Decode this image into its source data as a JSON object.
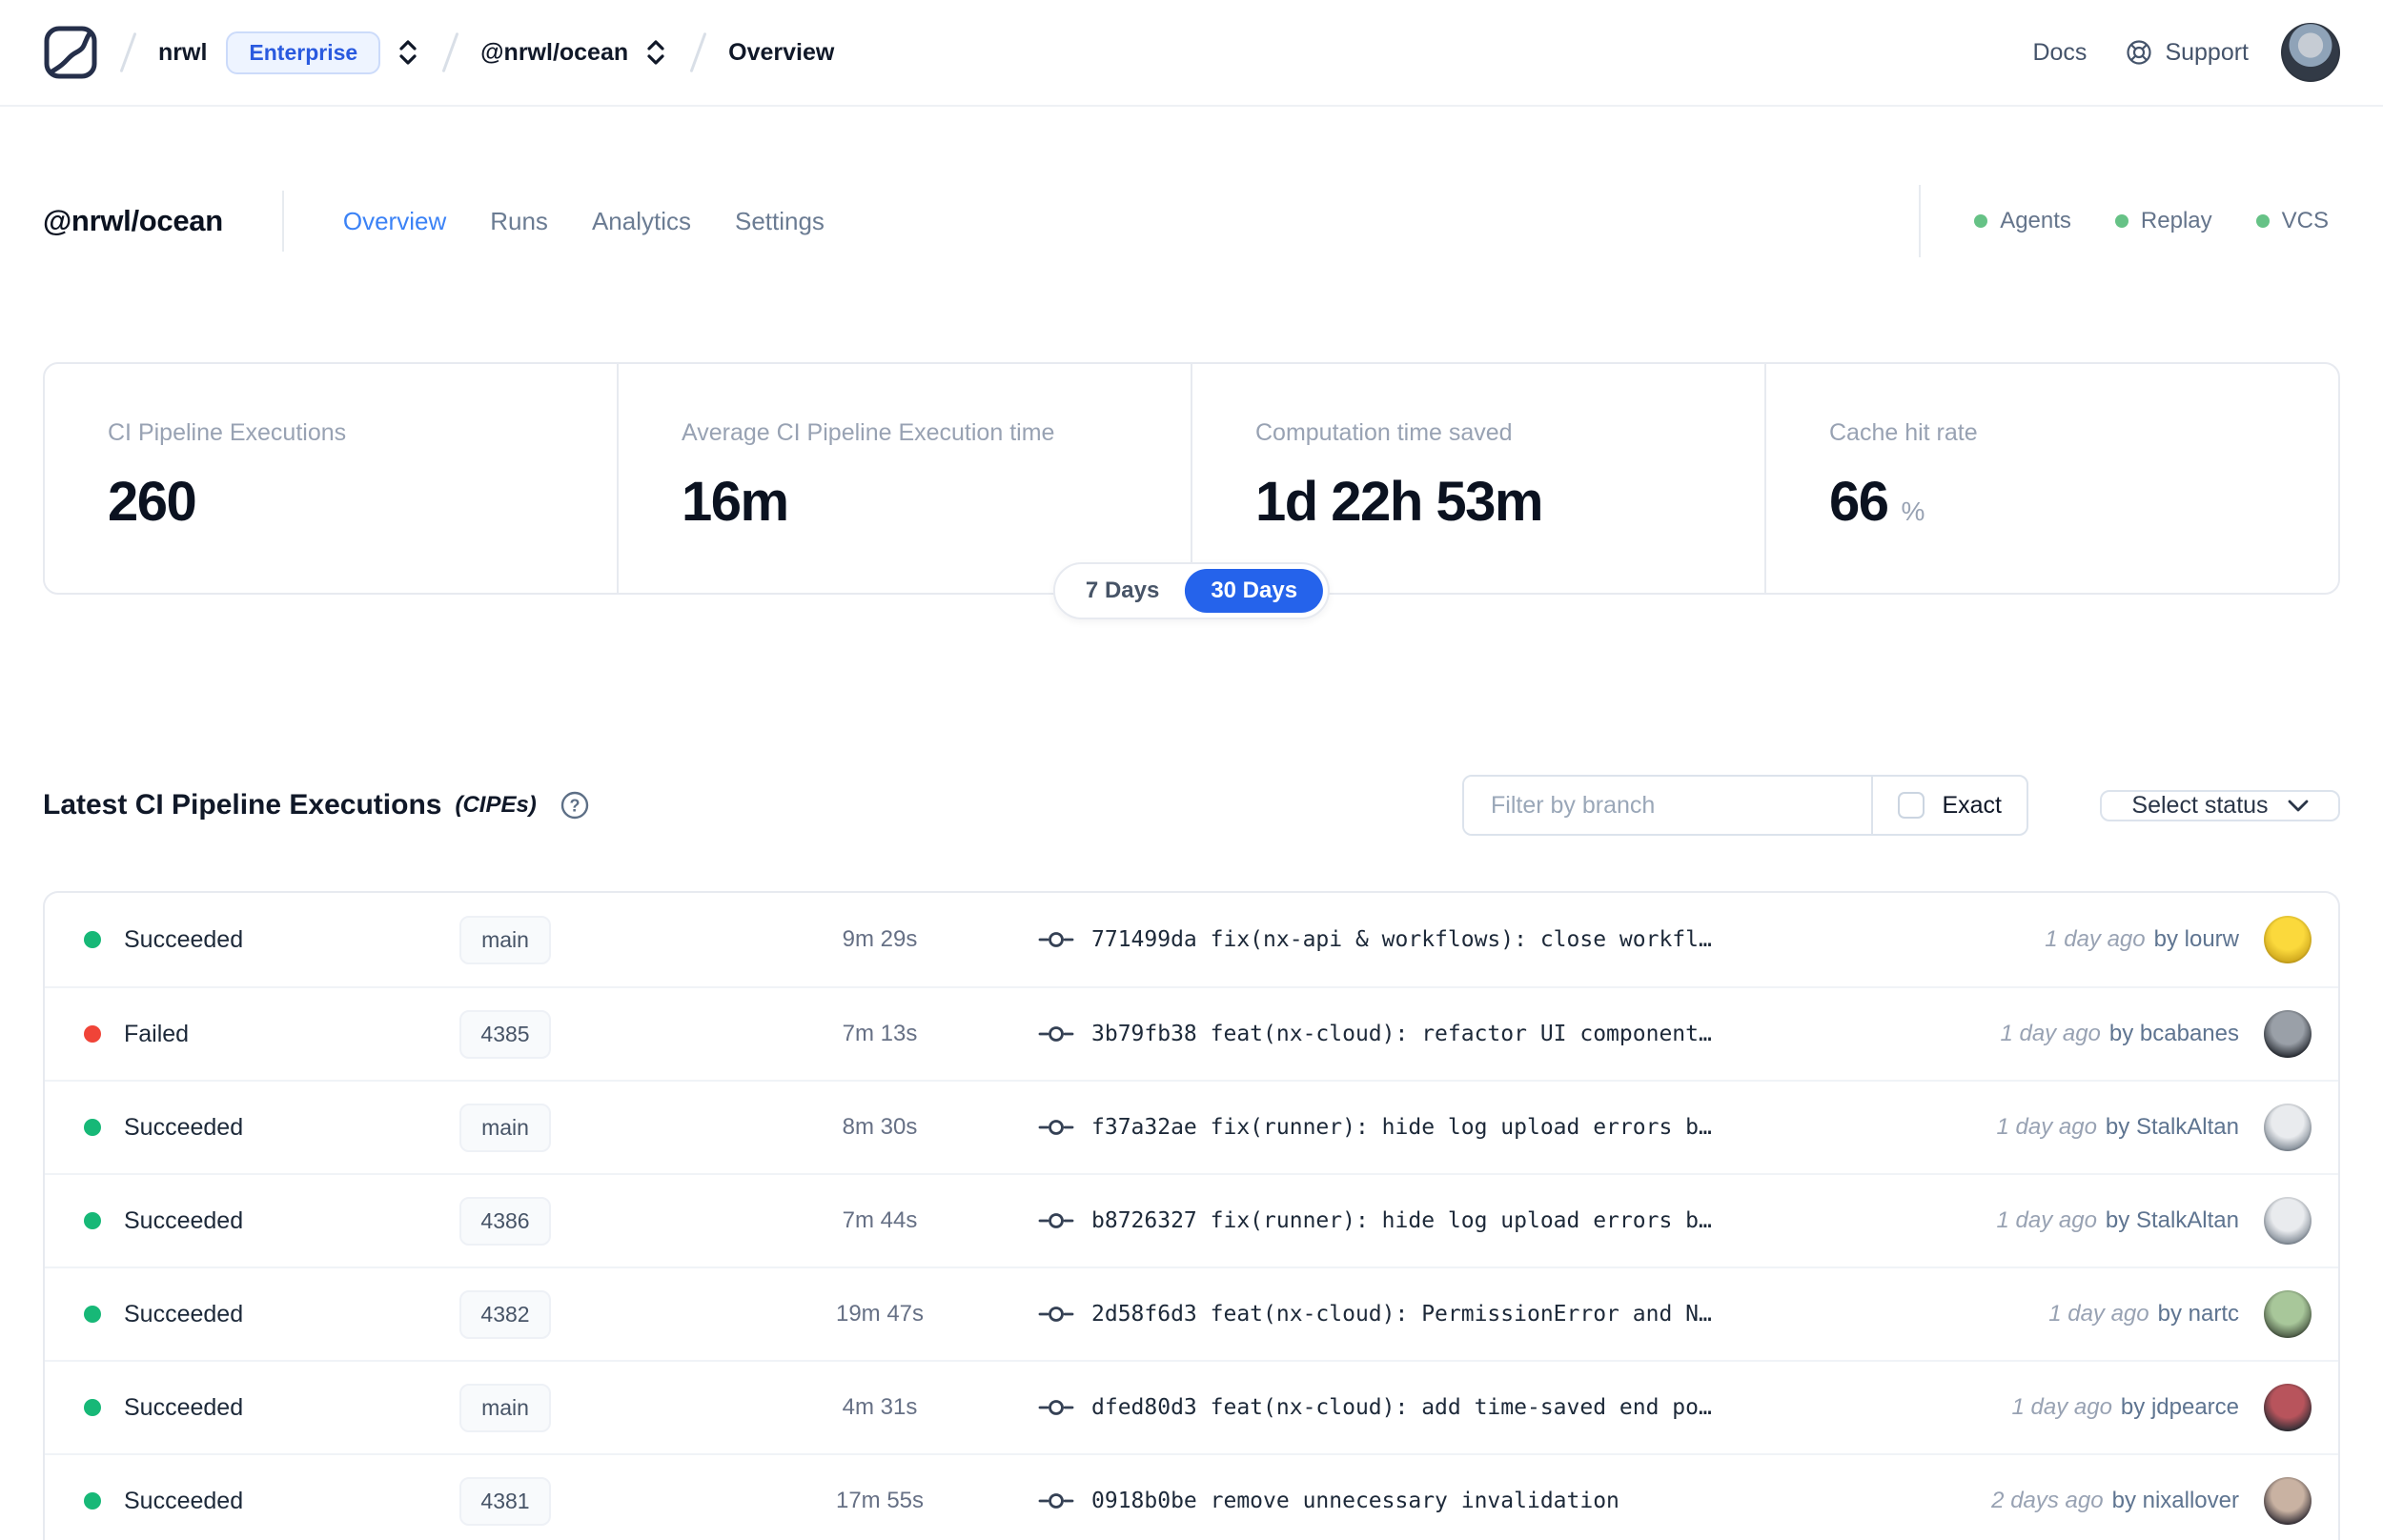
{
  "header": {
    "breadcrumb": {
      "org": "nrwl",
      "org_badge": "Enterprise",
      "workspace": "@nrwl/ocean",
      "page": "Overview"
    },
    "nav": {
      "docs": "Docs",
      "support": "Support"
    }
  },
  "workspace": {
    "title": "@nrwl/ocean",
    "tabs": [
      {
        "label": "Overview",
        "active": true
      },
      {
        "label": "Runs",
        "active": false
      },
      {
        "label": "Analytics",
        "active": false
      },
      {
        "label": "Settings",
        "active": false
      }
    ],
    "integrations": [
      {
        "label": "Agents"
      },
      {
        "label": "Replay"
      },
      {
        "label": "VCS"
      }
    ]
  },
  "stats": {
    "cards": [
      {
        "label": "CI Pipeline Executions",
        "value": "260"
      },
      {
        "label": "Average CI Pipeline Execution time",
        "value": "16m"
      },
      {
        "label": "Computation time saved",
        "value": "1d 22h 53m"
      },
      {
        "label": "Cache hit rate",
        "value": "66",
        "unit": "%"
      }
    ],
    "range_toggle": {
      "options": [
        "7 Days",
        "30 Days"
      ],
      "selected": "30 Days"
    }
  },
  "executions": {
    "title": "Latest CI Pipeline Executions",
    "title_suffix": "(CIPEs)",
    "filter": {
      "placeholder": "Filter by branch",
      "exact_label": "Exact",
      "status_label": "Select status"
    },
    "rows": [
      {
        "status": "Succeeded",
        "branch": "main",
        "duration": "9m 29s",
        "commit": "771499da",
        "message": "fix(nx-api & workflows): close workfl…",
        "time": "1 day ago",
        "author": "by lourw",
        "avatar": [
          "#fbd93c",
          "#caa21a"
        ]
      },
      {
        "status": "Failed",
        "branch": "4385",
        "duration": "7m 13s",
        "commit": "3b79fb38",
        "message": "feat(nx-cloud): refactor UI component…",
        "time": "1 day ago",
        "author": "by bcabanes",
        "avatar": [
          "#9aa0a8",
          "#23272e"
        ]
      },
      {
        "status": "Succeeded",
        "branch": "main",
        "duration": "8m 30s",
        "commit": "f37a32ae",
        "message": "fix(runner): hide log upload errors b…",
        "time": "1 day ago",
        "author": "by StalkAltan",
        "avatar": [
          "#e9ebee",
          "#7c8691"
        ]
      },
      {
        "status": "Succeeded",
        "branch": "4386",
        "duration": "7m 44s",
        "commit": "b8726327",
        "message": "fix(runner): hide log upload errors b…",
        "time": "1 day ago",
        "author": "by StalkAltan",
        "avatar": [
          "#e9ebee",
          "#7c8691"
        ]
      },
      {
        "status": "Succeeded",
        "branch": "4382",
        "duration": "19m 47s",
        "commit": "2d58f6d3",
        "message": "feat(nx-cloud): PermissionError and N…",
        "time": "1 day ago",
        "author": "by nartc",
        "avatar": [
          "#a8c79a",
          "#45523f"
        ]
      },
      {
        "status": "Succeeded",
        "branch": "main",
        "duration": "4m 31s",
        "commit": "dfed80d3",
        "message": "feat(nx-cloud): add time-saved end po…",
        "time": "1 day ago",
        "author": "by jdpearce",
        "avatar": [
          "#b8545c",
          "#2a2d34"
        ]
      },
      {
        "status": "Succeeded",
        "branch": "4381",
        "duration": "17m 55s",
        "commit": "0918b0be",
        "message": "remove unnecessary invalidation",
        "time": "2 days ago",
        "author": "by nixallover",
        "avatar": [
          "#c9b2a2",
          "#322d35"
        ]
      }
    ]
  },
  "colors": {
    "status": {
      "Succeeded": "#17b877",
      "Failed": "#f04438"
    },
    "accent_blue": "#2563eb",
    "chip_green": "#66c286"
  }
}
